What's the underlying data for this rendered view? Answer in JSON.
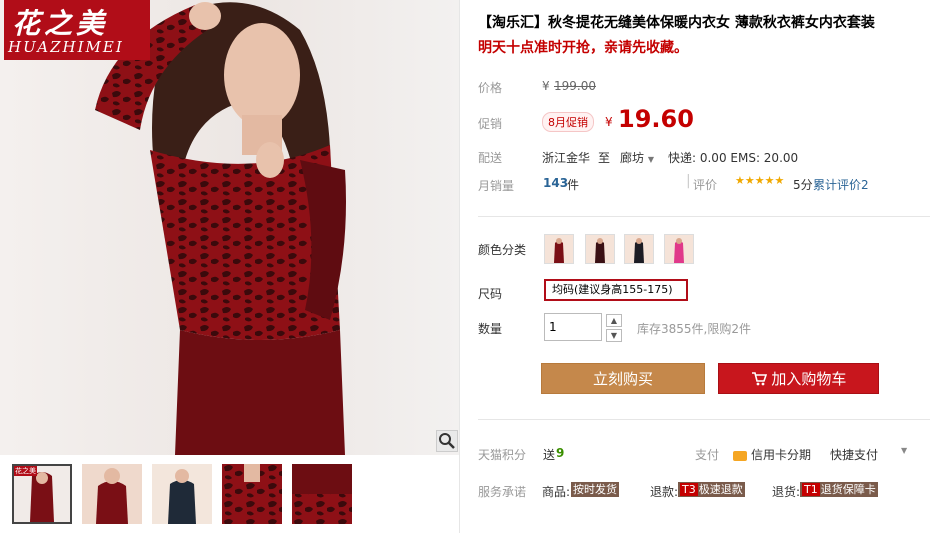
{
  "brand": {
    "name_cn": "花之美",
    "name_en": "HUAZHIMEI"
  },
  "product": {
    "title": "【淘乐汇】秋冬提花无缝美体保暖内衣女 薄款秋衣裤女内衣套装",
    "subtitle": "明天十点准时开抢，亲请先收藏。"
  },
  "price": {
    "label": "价格",
    "currency": "¥",
    "original": "199.00",
    "promo_label": "促销",
    "promo_tag": "8月促销",
    "promo_price": "19.60"
  },
  "shipping": {
    "label": "配送",
    "from": "浙江金华",
    "to_word": "至",
    "dest": "廊坊",
    "fee": "快递: 0.00 EMS: 20.00"
  },
  "sales": {
    "label": "月销量",
    "count": "143",
    "unit": "件",
    "rating_label": "评价",
    "stars": "★★★★★",
    "score_text": "5分",
    "review_text": "累计评价2"
  },
  "options": {
    "color_label": "颜色分类",
    "colors": [
      "dark-red",
      "black-red",
      "black",
      "pink"
    ],
    "size_label": "尺码",
    "size_value": "均码(建议身高155-175)",
    "qty_label": "数量",
    "qty_value": "1",
    "stock_text": "库存3855件,限购2件"
  },
  "actions": {
    "buy_label": "立刻购买",
    "cart_label": "加入购物车"
  },
  "points": {
    "label": "天猫积分",
    "send": "送",
    "value": "9"
  },
  "pay": {
    "label": "支付",
    "installment": "信用卡分期",
    "quick": "快捷支付"
  },
  "service": {
    "label": "服务承诺",
    "goods_label": "商品:",
    "goods_badge": "按时发货",
    "refund_label": "退款:",
    "refund_code": "T3",
    "refund_badge": "极速退款",
    "return_label": "退货:",
    "return_code": "T1",
    "return_badge": "退货保障卡"
  },
  "colors": {
    "brand_red": "#b10d18",
    "price_red": "#c40000",
    "buy": "#c5884b",
    "cart": "#c8161d"
  },
  "icons": [
    "zoom-icon",
    "cart-icon",
    "credit-card-icon",
    "chevron-down-icon"
  ]
}
